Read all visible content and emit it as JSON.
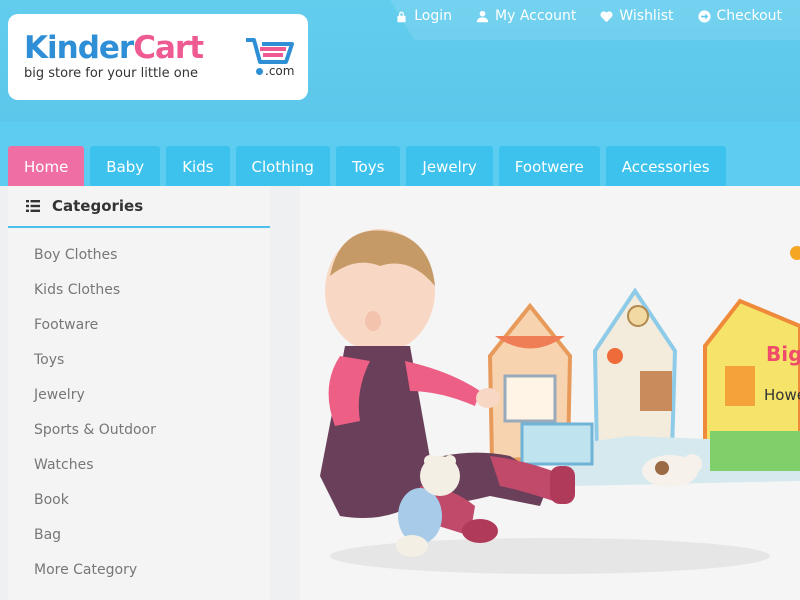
{
  "header": {
    "logo": {
      "word1": "Kinder",
      "word2": "Cart",
      "tagline": "big store for your little one",
      "domain": ".com"
    },
    "links": [
      {
        "label": "Login",
        "icon": "lock-icon"
      },
      {
        "label": "My Account",
        "icon": "user-icon"
      },
      {
        "label": "Wishlist",
        "icon": "heart-icon"
      },
      {
        "label": "Checkout",
        "icon": "arrow-circle-icon"
      }
    ]
  },
  "nav": {
    "tabs": [
      {
        "label": "Home",
        "active": true
      },
      {
        "label": "Baby"
      },
      {
        "label": "Kids"
      },
      {
        "label": "Clothing"
      },
      {
        "label": "Toys"
      },
      {
        "label": "Jewelry"
      },
      {
        "label": "Footwere"
      },
      {
        "label": "Accessories"
      }
    ]
  },
  "sidebar": {
    "title": "Categories",
    "items": [
      {
        "label": "Boy Clothes"
      },
      {
        "label": "Kids Clothes"
      },
      {
        "label": "Footware"
      },
      {
        "label": "Toys"
      },
      {
        "label": "Jewelry"
      },
      {
        "label": "Sports & Outdoor"
      },
      {
        "label": "Watches"
      },
      {
        "label": "Book"
      },
      {
        "label": "Bag"
      },
      {
        "label": "More Category"
      }
    ]
  },
  "slider": {
    "title": "Big",
    "subtitle": "Howe"
  },
  "colors": {
    "header_bg": "#5cc8ec",
    "tab_bg": "#3cc2ec",
    "tab_active": "#ef6fa4",
    "logo_blue": "#2f8fd6",
    "logo_pink": "#ee5b93",
    "accent_line": "#4cc0e8"
  }
}
